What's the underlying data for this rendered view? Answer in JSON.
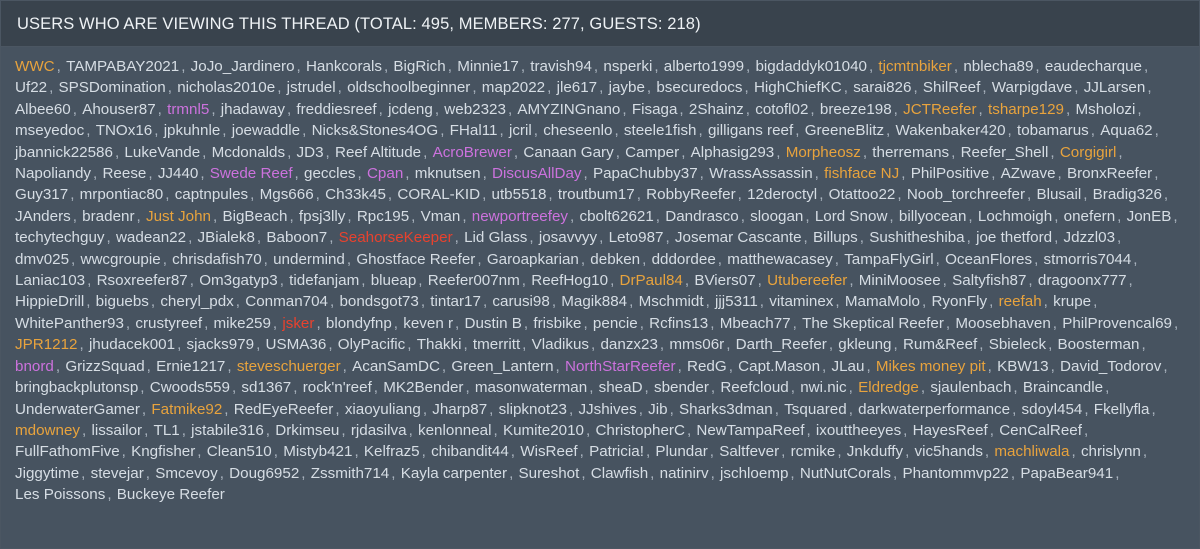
{
  "panel": {
    "header_title": "USERS WHO ARE VIEWING THIS THREAD (TOTAL: 495, MEMBERS: 277, GUESTS: 218)",
    "totals": {
      "total": 495,
      "members": 277,
      "guests": 218
    },
    "separator": ",",
    "colors": {
      "panel_background": "#39434d",
      "list_background": "#475360",
      "border": "#4b5662",
      "page_background": "#2f3841",
      "header_text": "#eef2f5",
      "default_name": "#d6dde4",
      "orange_name": "#e8a33d",
      "magenta_name": "#cc72dd",
      "red_name": "#e8422e",
      "separator": "#aab4bf"
    }
  },
  "users": [
    {
      "name": "WWC",
      "color": "orange"
    },
    {
      "name": "TAMPABAY2021",
      "color": "default"
    },
    {
      "name": "JoJo_Jardinero",
      "color": "default"
    },
    {
      "name": "Hankcorals",
      "color": "default"
    },
    {
      "name": "BigRich",
      "color": "default"
    },
    {
      "name": "Minnie17",
      "color": "default"
    },
    {
      "name": "travish94",
      "color": "default"
    },
    {
      "name": "nsperki",
      "color": "default"
    },
    {
      "name": "alberto1999",
      "color": "default"
    },
    {
      "name": "bigdaddyk01040",
      "color": "default"
    },
    {
      "name": "tjcmtnbiker",
      "color": "orange"
    },
    {
      "name": "nblecha89",
      "color": "default"
    },
    {
      "name": "eaudecharque",
      "color": "default"
    },
    {
      "name": "Uf22",
      "color": "default"
    },
    {
      "name": "SPSDomination",
      "color": "default"
    },
    {
      "name": "nicholas2010e",
      "color": "default"
    },
    {
      "name": "jstrudel",
      "color": "default"
    },
    {
      "name": "oldschoolbeginner",
      "color": "default"
    },
    {
      "name": "map2022",
      "color": "default"
    },
    {
      "name": "jle617",
      "color": "default"
    },
    {
      "name": "jaybe",
      "color": "default"
    },
    {
      "name": "bsecuredocs",
      "color": "default"
    },
    {
      "name": "HighChiefKC",
      "color": "default"
    },
    {
      "name": "sarai826",
      "color": "default"
    },
    {
      "name": "ShilReef",
      "color": "default"
    },
    {
      "name": "Warpigdave",
      "color": "default"
    },
    {
      "name": "JJLarsen",
      "color": "default"
    },
    {
      "name": "Albee60",
      "color": "default"
    },
    {
      "name": "Ahouser87",
      "color": "default"
    },
    {
      "name": "trmnl5",
      "color": "magenta"
    },
    {
      "name": "jhadaway",
      "color": "default"
    },
    {
      "name": "freddiesreef",
      "color": "default"
    },
    {
      "name": "jcdeng",
      "color": "default"
    },
    {
      "name": "web2323",
      "color": "default"
    },
    {
      "name": "AMYZINGnano",
      "color": "default"
    },
    {
      "name": "Fisaga",
      "color": "default"
    },
    {
      "name": "2Shainz",
      "color": "default"
    },
    {
      "name": "cotofl02",
      "color": "default"
    },
    {
      "name": "breeze198",
      "color": "default"
    },
    {
      "name": "JCTReefer",
      "color": "orange"
    },
    {
      "name": "tsharpe129",
      "color": "orange"
    },
    {
      "name": "Msholozi",
      "color": "default"
    },
    {
      "name": "mseyedoc",
      "color": "default"
    },
    {
      "name": "TNOx16",
      "color": "default"
    },
    {
      "name": "jpkuhnle",
      "color": "default"
    },
    {
      "name": "joewaddle",
      "color": "default"
    },
    {
      "name": "Nicks&Stones4OG",
      "color": "default"
    },
    {
      "name": "FHal11",
      "color": "default"
    },
    {
      "name": "jcril",
      "color": "default"
    },
    {
      "name": "cheseenlo",
      "color": "default"
    },
    {
      "name": "steele1fish",
      "color": "default"
    },
    {
      "name": "gilligans reef",
      "color": "default"
    },
    {
      "name": "GreeneBlitz",
      "color": "default"
    },
    {
      "name": "Wakenbaker420",
      "color": "default"
    },
    {
      "name": "tobamarus",
      "color": "default"
    },
    {
      "name": "Aqua62",
      "color": "default"
    },
    {
      "name": "jbannick22586",
      "color": "default"
    },
    {
      "name": "LukeVande",
      "color": "default"
    },
    {
      "name": "Mcdonalds",
      "color": "default"
    },
    {
      "name": "JD3",
      "color": "default"
    },
    {
      "name": "Reef Altitude",
      "color": "default"
    },
    {
      "name": "AcroBrewer",
      "color": "magenta"
    },
    {
      "name": "Canaan Gary",
      "color": "default"
    },
    {
      "name": "Camper",
      "color": "default"
    },
    {
      "name": "Alphasig293",
      "color": "default"
    },
    {
      "name": "Morpheosz",
      "color": "orange"
    },
    {
      "name": "therremans",
      "color": "default"
    },
    {
      "name": "Reefer_Shell",
      "color": "default"
    },
    {
      "name": "Corgigirl",
      "color": "orange"
    },
    {
      "name": "Napoliandy",
      "color": "default"
    },
    {
      "name": "Reese",
      "color": "default"
    },
    {
      "name": "JJ440",
      "color": "default"
    },
    {
      "name": "Swede Reef",
      "color": "magenta"
    },
    {
      "name": "geccles",
      "color": "default"
    },
    {
      "name": "Cpan",
      "color": "magenta"
    },
    {
      "name": "mknutsen",
      "color": "default"
    },
    {
      "name": "DiscusAllDay",
      "color": "magenta"
    },
    {
      "name": "PapaChubby37",
      "color": "default"
    },
    {
      "name": "WrassAssassin",
      "color": "default"
    },
    {
      "name": "fishface NJ",
      "color": "orange"
    },
    {
      "name": "PhilPositive",
      "color": "default"
    },
    {
      "name": "AZwave",
      "color": "default"
    },
    {
      "name": "BronxReefer",
      "color": "default"
    },
    {
      "name": "Guy317",
      "color": "default"
    },
    {
      "name": "mrpontiac80",
      "color": "default"
    },
    {
      "name": "captnpules",
      "color": "default"
    },
    {
      "name": "Mgs666",
      "color": "default"
    },
    {
      "name": "Ch33k45",
      "color": "default"
    },
    {
      "name": "CORAL-KID",
      "color": "default"
    },
    {
      "name": "utb5518",
      "color": "default"
    },
    {
      "name": "troutbum17",
      "color": "default"
    },
    {
      "name": "RobbyReefer",
      "color": "default"
    },
    {
      "name": "12deroctyl",
      "color": "default"
    },
    {
      "name": "Otattoo22",
      "color": "default"
    },
    {
      "name": "Noob_torchreefer",
      "color": "default"
    },
    {
      "name": "Blusail",
      "color": "default"
    },
    {
      "name": "Bradig326",
      "color": "default"
    },
    {
      "name": "JAnders",
      "color": "default"
    },
    {
      "name": "bradenr",
      "color": "default"
    },
    {
      "name": "Just John",
      "color": "orange"
    },
    {
      "name": "BigBeach",
      "color": "default"
    },
    {
      "name": "fpsj3lly",
      "color": "default"
    },
    {
      "name": "Rpc195",
      "color": "default"
    },
    {
      "name": "Vman",
      "color": "default"
    },
    {
      "name": "newportreefey",
      "color": "magenta"
    },
    {
      "name": "cbolt62621",
      "color": "default"
    },
    {
      "name": "Dandrasco",
      "color": "default"
    },
    {
      "name": "sloogan",
      "color": "default"
    },
    {
      "name": "Lord Snow",
      "color": "default"
    },
    {
      "name": "billyocean",
      "color": "default"
    },
    {
      "name": "Lochmoigh",
      "color": "default"
    },
    {
      "name": "onefern",
      "color": "default"
    },
    {
      "name": "JonEB",
      "color": "default"
    },
    {
      "name": "techytechguy",
      "color": "default"
    },
    {
      "name": "wadean22",
      "color": "default"
    },
    {
      "name": "JBialek8",
      "color": "default"
    },
    {
      "name": "Baboon7",
      "color": "default"
    },
    {
      "name": "SeahorseKeeper",
      "color": "red"
    },
    {
      "name": "Lid Glass",
      "color": "default"
    },
    {
      "name": "josavvyy",
      "color": "default"
    },
    {
      "name": "Leto987",
      "color": "default"
    },
    {
      "name": "Josemar Cascante",
      "color": "default"
    },
    {
      "name": "Billups",
      "color": "default"
    },
    {
      "name": "Sushitheshiba",
      "color": "default"
    },
    {
      "name": "joe thetford",
      "color": "default"
    },
    {
      "name": "Jdzzl03",
      "color": "default"
    },
    {
      "name": "dmv025",
      "color": "default"
    },
    {
      "name": "wwcgroupie",
      "color": "default"
    },
    {
      "name": "chrisdafish70",
      "color": "default"
    },
    {
      "name": "undermind",
      "color": "default"
    },
    {
      "name": "Ghostface Reefer",
      "color": "default"
    },
    {
      "name": "Garoapkarian",
      "color": "default"
    },
    {
      "name": "debken",
      "color": "default"
    },
    {
      "name": "dddordee",
      "color": "default"
    },
    {
      "name": "matthewacasey",
      "color": "default"
    },
    {
      "name": "TampaFlyGirl",
      "color": "default"
    },
    {
      "name": "OceanFlores",
      "color": "default"
    },
    {
      "name": "stmorris7044",
      "color": "default"
    },
    {
      "name": "Laniac103",
      "color": "default"
    },
    {
      "name": "Rsoxreefer87",
      "color": "default"
    },
    {
      "name": "Om3gatyp3",
      "color": "default"
    },
    {
      "name": "tidefanjam",
      "color": "default"
    },
    {
      "name": "blueap",
      "color": "default"
    },
    {
      "name": "Reefer007nm",
      "color": "default"
    },
    {
      "name": "ReefHog10",
      "color": "default"
    },
    {
      "name": "DrPaul84",
      "color": "orange"
    },
    {
      "name": "BViers07",
      "color": "default"
    },
    {
      "name": "Utubereefer",
      "color": "orange"
    },
    {
      "name": "MiniMoosee",
      "color": "default"
    },
    {
      "name": "Saltyfish87",
      "color": "default"
    },
    {
      "name": "dragoonx777",
      "color": "default"
    },
    {
      "name": "HippieDrill",
      "color": "default"
    },
    {
      "name": "biguebs",
      "color": "default"
    },
    {
      "name": "cheryl_pdx",
      "color": "default"
    },
    {
      "name": "Conman704",
      "color": "default"
    },
    {
      "name": "bondsgot73",
      "color": "default"
    },
    {
      "name": "tintar17",
      "color": "default"
    },
    {
      "name": "carusi98",
      "color": "default"
    },
    {
      "name": "Magik884",
      "color": "default"
    },
    {
      "name": "Mschmidt",
      "color": "default"
    },
    {
      "name": "jjj5311",
      "color": "default"
    },
    {
      "name": "vitaminex",
      "color": "default"
    },
    {
      "name": "MamaMolo",
      "color": "default"
    },
    {
      "name": "RyonFly",
      "color": "default"
    },
    {
      "name": "reefah",
      "color": "orange"
    },
    {
      "name": "krupe",
      "color": "default"
    },
    {
      "name": "WhitePanther93",
      "color": "default"
    },
    {
      "name": "crustyreef",
      "color": "default"
    },
    {
      "name": "mike259",
      "color": "default"
    },
    {
      "name": "jsker",
      "color": "red"
    },
    {
      "name": "blondyfnp",
      "color": "default"
    },
    {
      "name": "keven r",
      "color": "default"
    },
    {
      "name": "Dustin B",
      "color": "default"
    },
    {
      "name": "frisbike",
      "color": "default"
    },
    {
      "name": "pencie",
      "color": "default"
    },
    {
      "name": "Rcfins13",
      "color": "default"
    },
    {
      "name": "Mbeach77",
      "color": "default"
    },
    {
      "name": "The Skeptical Reefer",
      "color": "default"
    },
    {
      "name": "Moosebhaven",
      "color": "default"
    },
    {
      "name": "PhilProvencal69",
      "color": "default"
    },
    {
      "name": "JPR1212",
      "color": "orange"
    },
    {
      "name": "jhudacek001",
      "color": "default"
    },
    {
      "name": "sjacks979",
      "color": "default"
    },
    {
      "name": "USMA36",
      "color": "default"
    },
    {
      "name": "OlyPacific",
      "color": "default"
    },
    {
      "name": "Thakki",
      "color": "default"
    },
    {
      "name": "tmerritt",
      "color": "default"
    },
    {
      "name": "Vladikus",
      "color": "default"
    },
    {
      "name": "danzx23",
      "color": "default"
    },
    {
      "name": "mms06r",
      "color": "default"
    },
    {
      "name": "Darth_Reefer",
      "color": "default"
    },
    {
      "name": "gkleung",
      "color": "default"
    },
    {
      "name": "Rum&Reef",
      "color": "default"
    },
    {
      "name": "Sbieleck",
      "color": "default"
    },
    {
      "name": "Boosterman",
      "color": "default"
    },
    {
      "name": "bnord",
      "color": "magenta"
    },
    {
      "name": "GrizzSquad",
      "color": "default"
    },
    {
      "name": "Ernie1217",
      "color": "default"
    },
    {
      "name": "steveschuerger",
      "color": "orange"
    },
    {
      "name": "AcanSamDC",
      "color": "default"
    },
    {
      "name": "Green_Lantern",
      "color": "default"
    },
    {
      "name": "NorthStarReefer",
      "color": "magenta"
    },
    {
      "name": "RedG",
      "color": "default"
    },
    {
      "name": "Capt.Mason",
      "color": "default"
    },
    {
      "name": "JLau",
      "color": "default"
    },
    {
      "name": "Mikes money pit",
      "color": "orange"
    },
    {
      "name": "KBW13",
      "color": "default"
    },
    {
      "name": "David_Todorov",
      "color": "default"
    },
    {
      "name": "bringbackplutonsp",
      "color": "default"
    },
    {
      "name": "Cwoods559",
      "color": "default"
    },
    {
      "name": "sd1367",
      "color": "default"
    },
    {
      "name": "rock'n'reef",
      "color": "default"
    },
    {
      "name": "MK2Bender",
      "color": "default"
    },
    {
      "name": "masonwaterman",
      "color": "default"
    },
    {
      "name": "sheaD",
      "color": "default"
    },
    {
      "name": "sbender",
      "color": "default"
    },
    {
      "name": "Reefcloud",
      "color": "default"
    },
    {
      "name": "nwi.nic",
      "color": "default"
    },
    {
      "name": "Eldredge",
      "color": "orange"
    },
    {
      "name": "sjaulenbach",
      "color": "default"
    },
    {
      "name": "Braincandle",
      "color": "default"
    },
    {
      "name": "UnderwaterGamer",
      "color": "default"
    },
    {
      "name": "Fatmike92",
      "color": "orange"
    },
    {
      "name": "RedEyeReefer",
      "color": "default"
    },
    {
      "name": "xiaoyuliang",
      "color": "default"
    },
    {
      "name": "Jharp87",
      "color": "default"
    },
    {
      "name": "slipknot23",
      "color": "default"
    },
    {
      "name": "JJshives",
      "color": "default"
    },
    {
      "name": "Jib",
      "color": "default"
    },
    {
      "name": "Sharks3dman",
      "color": "default"
    },
    {
      "name": "Tsquared",
      "color": "default"
    },
    {
      "name": "darkwaterperformance",
      "color": "default"
    },
    {
      "name": "sdoyl454",
      "color": "default"
    },
    {
      "name": "Fkellyfla",
      "color": "default"
    },
    {
      "name": "mdowney",
      "color": "orange"
    },
    {
      "name": "lissailor",
      "color": "default"
    },
    {
      "name": "TL1",
      "color": "default"
    },
    {
      "name": "jstabile316",
      "color": "default"
    },
    {
      "name": "Drkimseu",
      "color": "default"
    },
    {
      "name": "rjdasilva",
      "color": "default"
    },
    {
      "name": "kenlonneal",
      "color": "default"
    },
    {
      "name": "Kumite2010",
      "color": "default"
    },
    {
      "name": "ChristopherC",
      "color": "default"
    },
    {
      "name": "NewTampaReef",
      "color": "default"
    },
    {
      "name": "ixouttheeyes",
      "color": "default"
    },
    {
      "name": "HayesReef",
      "color": "default"
    },
    {
      "name": "CenCalReef",
      "color": "default"
    },
    {
      "name": "FullFathomFive",
      "color": "default"
    },
    {
      "name": "Kngfisher",
      "color": "default"
    },
    {
      "name": "Clean510",
      "color": "default"
    },
    {
      "name": "Mistyb421",
      "color": "default"
    },
    {
      "name": "Kelfraz5",
      "color": "default"
    },
    {
      "name": "chibandit44",
      "color": "default"
    },
    {
      "name": "WisReef",
      "color": "default"
    },
    {
      "name": "Patricia!",
      "color": "default"
    },
    {
      "name": "Plundar",
      "color": "default"
    },
    {
      "name": "Saltfever",
      "color": "default"
    },
    {
      "name": "rcmike",
      "color": "default"
    },
    {
      "name": "Jnkduffy",
      "color": "default"
    },
    {
      "name": "vic5hands",
      "color": "default"
    },
    {
      "name": "machliwala",
      "color": "orange"
    },
    {
      "name": "chrislynn",
      "color": "default"
    },
    {
      "name": "Jiggytime",
      "color": "default"
    },
    {
      "name": "stevejar",
      "color": "default"
    },
    {
      "name": "Smcevoy",
      "color": "default"
    },
    {
      "name": "Doug6952",
      "color": "default"
    },
    {
      "name": "Zssmith714",
      "color": "default"
    },
    {
      "name": "Kayla carpenter",
      "color": "default"
    },
    {
      "name": "Sureshot",
      "color": "default"
    },
    {
      "name": "Clawfish",
      "color": "default"
    },
    {
      "name": "natinirv",
      "color": "default"
    },
    {
      "name": "jschloemp",
      "color": "default"
    },
    {
      "name": "NutNutCorals",
      "color": "default"
    },
    {
      "name": "Phantommvp22",
      "color": "default"
    },
    {
      "name": "PapaBear941",
      "color": "default"
    },
    {
      "name": "Les Poissons",
      "color": "default"
    },
    {
      "name": "Buckeye Reefer",
      "color": "default"
    }
  ]
}
